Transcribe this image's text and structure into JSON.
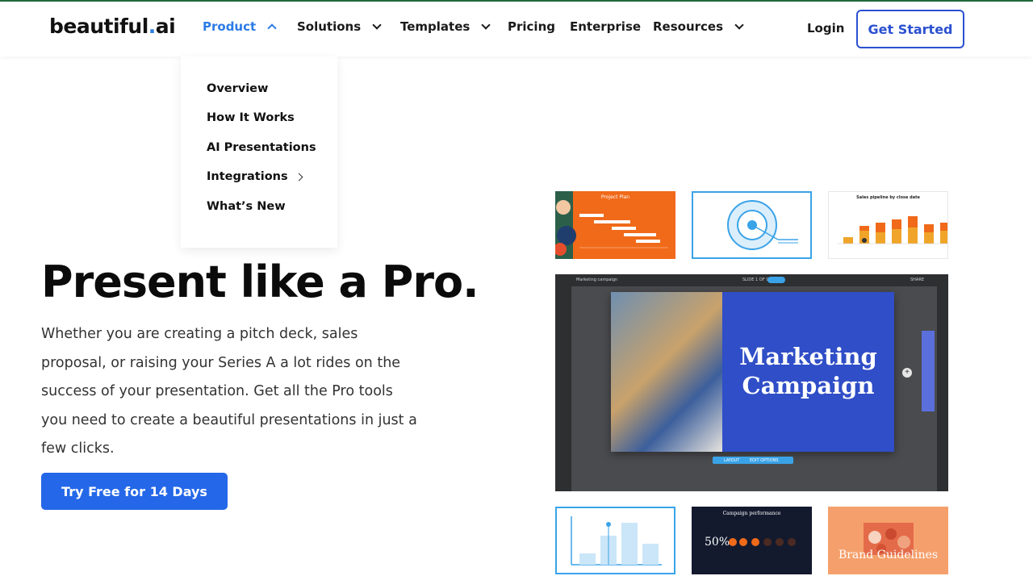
{
  "header": {
    "logo_main": "beautiful",
    "logo_dot": ".",
    "logo_suffix": "ai",
    "nav": [
      "Product",
      "Solutions",
      "Templates",
      "Pricing",
      "Enterprise",
      "Resources"
    ],
    "login": "Login",
    "get_started": "Get Started"
  },
  "dropdown": {
    "items": [
      "Overview",
      "How It Works",
      "AI Presentations",
      "Integrations",
      "What’s New"
    ]
  },
  "hero": {
    "title": "Present like a Pro.",
    "text": "Whether you are creating a pitch deck, sales proposal, or raising your Series A a lot rides on the success of your presentation. Get all the Pro tools you need to create a beautiful presentations in just a few clicks.",
    "cta": "Try Free for 14 Days"
  },
  "thumbs": {
    "project_plan": "Project Plan",
    "sales_pipeline": "Sales pipeline by close date",
    "campaign_perf": "Campaign performance",
    "percent": "50%",
    "brand": "Brand Guidelines"
  },
  "editor": {
    "doc_name": "Marketing campaign",
    "slide_count": "SLIDE 1 OF 9",
    "slide_title": "Marketing Campaign",
    "share": "SHARE",
    "layout": "LAYOUT",
    "edit_options": "EDIT OPTIONS"
  },
  "colors": {
    "accent": "#2467e8",
    "nav_active": "#2c7be5",
    "slide_blue": "#2f4ec7",
    "orange": "#f06a1a"
  }
}
